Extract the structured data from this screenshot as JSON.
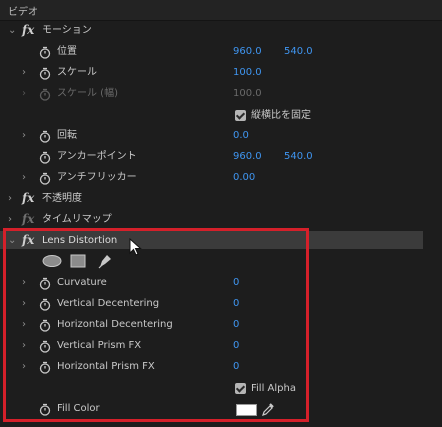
{
  "panel": {
    "title": "ビデオ"
  },
  "motion": {
    "name": "モーション",
    "position": {
      "label": "位置",
      "x": "960.0",
      "y": "540.0"
    },
    "scale": {
      "label": "スケール",
      "value": "100.0"
    },
    "scale_width": {
      "label": "スケール (幅)",
      "value": "100.0"
    },
    "uniform_scale": {
      "label": "縦横比を固定",
      "checked": true
    },
    "rotation": {
      "label": "回転",
      "value": "0.0"
    },
    "anchor": {
      "label": "アンカーポイント",
      "x": "960.0",
      "y": "540.0"
    },
    "antiflicker": {
      "label": "アンチフリッカー",
      "value": "0.00"
    }
  },
  "opacity": {
    "name": "不透明度"
  },
  "time_remap": {
    "name": "タイムリマップ"
  },
  "lens": {
    "name": "Lens Distortion",
    "tools": [
      "ellipse-mask",
      "rectangle-mask",
      "pen-mask"
    ],
    "curvature": {
      "label": "Curvature",
      "value": "0"
    },
    "v_decenter": {
      "label": "Vertical Decentering",
      "value": "0"
    },
    "h_decenter": {
      "label": "Horizontal Decentering",
      "value": "0"
    },
    "v_prism": {
      "label": "Vertical Prism FX",
      "value": "0"
    },
    "h_prism": {
      "label": "Horizontal Prism FX",
      "value": "0"
    },
    "fill_alpha": {
      "label": "Fill Alpha",
      "checked": true
    },
    "fill_color": {
      "label": "Fill Color",
      "color": "#ffffff"
    }
  },
  "colors": {
    "accent_value": "#3f95f0",
    "highlight_box": "#d5202a"
  }
}
